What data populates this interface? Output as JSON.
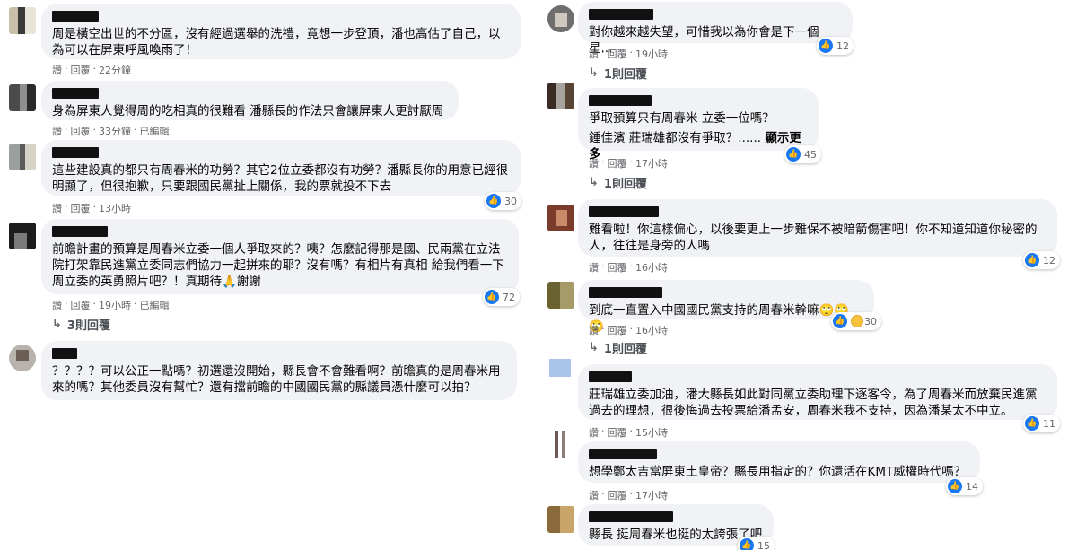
{
  "labels": {
    "like": "讚",
    "reply": "回覆",
    "edited": "已編輯",
    "dot": "·"
  },
  "colors": {
    "bubble": "#f0f2f5",
    "like_blue": "#1877f2",
    "meta_gray": "#65676b"
  },
  "left": [
    {
      "lines": [
        "周是橫空出世的不分區，沒有經過選舉的洗禮，竟想一步登頂，潘也高估了自己，以為可以在屏東呼風喚雨了！"
      ],
      "time": "22分鐘",
      "edited": false
    },
    {
      "lines": [
        "身為屏東人覺得周的吃相真的很難看 潘縣長的作法只會讓屏東人更討厭周"
      ],
      "time": "33分鐘",
      "edited": true
    },
    {
      "lines": [
        "這些建設真的都只有周春米的功勞？其它2位立委都沒有功勞？潘縣長你的用意已經很明顯了，但很抱歉，只要跟國民黨扯上關係，我的票就投不下去"
      ],
      "time": "13小時",
      "edited": false,
      "reactions": "30"
    },
    {
      "lines": [
        "前瞻計畫的預算是周春米立委一個人爭取來的？咦？怎麼記得那是國、民兩黨在立法院打架靠民進黨立委同志們協力一起拼來的耶？沒有嗎？有相片有真相 給我們看一下周立委的英勇照片吧？！真期待🙏謝謝"
      ],
      "time": "19小時",
      "edited": true,
      "reactions": "72",
      "replies": "3則回覆"
    },
    {
      "lines": [
        "？？？？可以公正一點嗎？初選還沒開始，縣長會不會難看啊？前瞻真的是周春米用來的嗎？其他委員沒有幫忙？還有擋前瞻的中國國民黨的縣議員憑什麼可以拍？"
      ]
    }
  ],
  "right": [
    {
      "lines": [
        "對你越來越失望，可惜我以為你會是下一個星..."
      ],
      "time": "19小時",
      "reactions": "12",
      "replies": "1則回覆"
    },
    {
      "lines": [
        "爭取預算只有周春米 立委一位嗎？",
        "鍾佳濱 莊瑞雄都沒有爭取？......"
      ],
      "more": "顯示更多",
      "time": "17小時",
      "reactions": "45",
      "replies": "1則回覆"
    },
    {
      "lines": [
        "難看啦！你這樣偏心，以後要更上一步難保不被暗箭傷害吧！你不知道知道你秘密的人，往往是身旁的人嗎"
      ],
      "time": "16小時",
      "reactions": "12"
    },
    {
      "lines": [
        "到底一直置入中國國民黨支持的周春米幹嘛🙄🙄🙄"
      ],
      "time": "16小時",
      "reactions": "30",
      "replies": "1則回覆"
    },
    {
      "lines": [
        "莊瑞雄立委加油，潘大縣長如此對同黨立委助理下逐客令，為了周春米而放棄民進黨過去的理想，很後悔過去投票給潘孟安，周春米我不支持，因為潘某太不中立。"
      ],
      "time": "15小時",
      "reactions": "11"
    },
    {
      "lines": [
        "想學鄭太吉當屏東土皇帝？縣長用指定的？你還活在KMT威權時代嗎？"
      ],
      "time": "17小時",
      "reactions": "14"
    },
    {
      "lines": [
        "縣長 挺周春米也挺的太誇張了吧"
      ],
      "reactions": "15"
    }
  ]
}
